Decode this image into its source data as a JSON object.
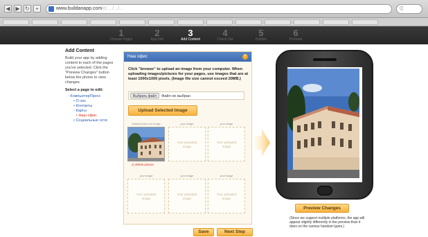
{
  "browser": {
    "url": "www.buildanapp.com",
    "url_rest": "/c/ .../.../...",
    "back_label": "◀",
    "forward_label": "▶",
    "reload_label": "↻",
    "add_label": "+",
    "search_label": "Q",
    "bookmark_count": 13
  },
  "steps": [
    {
      "num": "1",
      "label": "Choose Pages"
    },
    {
      "num": "2",
      "label": "App Info"
    },
    {
      "num": "3",
      "label": "Add Content"
    },
    {
      "num": "4",
      "label": "Check Out"
    },
    {
      "num": "5",
      "label": "Publish"
    },
    {
      "num": "6",
      "label": "Promote"
    }
  ],
  "active_step": 2,
  "left": {
    "title": "Add Content",
    "description": "Build your app by adding content to each of the pages you've selected. Click the \"Preview Changes\" button below the phone to view changes.",
    "select_label": "Select a page to edit:",
    "tree": [
      {
        "label": "- КомпьютерПресс",
        "level": "l1",
        "active": false
      },
      {
        "label": "• О нас",
        "level": "l2",
        "active": false
      },
      {
        "label": "• Контакты",
        "level": "l2",
        "active": false
      },
      {
        "label": "- Карты",
        "level": "l2",
        "active": false
      },
      {
        "label": "• Наш офис",
        "level": "l3",
        "active": true
      },
      {
        "label": "• Социальные сети",
        "level": "l2",
        "active": false
      }
    ]
  },
  "upload": {
    "header": "Наш офис",
    "help_icon": "?",
    "instructions": "Click \"browse\" to upload an image from your computer. When uploading images/pictures for your pages, use images that are at least 1000x1000 pixels. (Image file size cannot exceed 20MB.)",
    "choose_file_label": "Выбрать файл",
    "no_file_label": "Файл не выбран",
    "upload_button": "Upload Selected Image",
    "current_caption": "Default picture for Image",
    "delete_link": "x) delete picture",
    "slot_caption": "your image",
    "slot_placeholder": "Your uploaded image"
  },
  "actions": {
    "save": "Save",
    "next": "Next Step"
  },
  "preview": {
    "button": "Preview Changes",
    "note": "(Since we support multiple platforms, the app will appear slightly differently in the preview than it does on the various handset types.)"
  },
  "colors": {
    "accent_orange": "#f7b13f",
    "header_blue": "#4a78be",
    "link_blue": "#2a5db0",
    "active_red": "#d4301c"
  }
}
